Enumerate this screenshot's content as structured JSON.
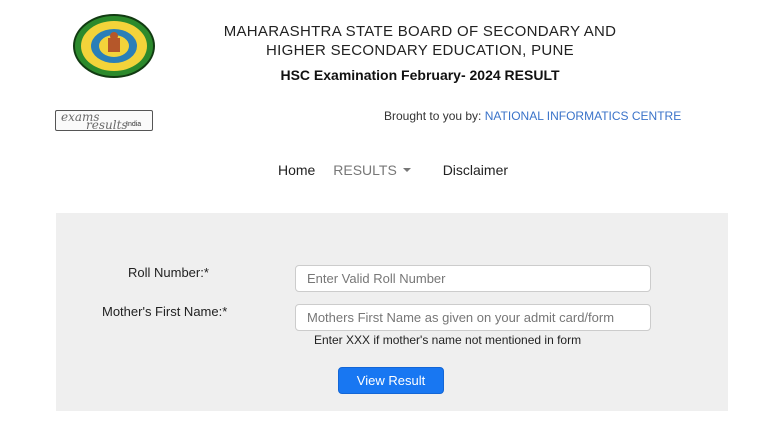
{
  "header": {
    "board_line1": "MAHARASHTRA STATE BOARD OF SECONDARY AND",
    "board_line2": "HIGHER SECONDARY EDUCATION, PUNE",
    "exam_title": "HSC Examination February- 2024 RESULT"
  },
  "partner": {
    "logo_word1": "exams",
    "logo_word2": "results",
    "logo_word3": "India",
    "brought_by_prefix": "Brought to you by:",
    "brought_by_org": "NATIONAL INFORMATICS CENTRE"
  },
  "nav": {
    "home": "Home",
    "results": "RESULTS",
    "disclaimer": "Disclaimer"
  },
  "form": {
    "roll_label": "Roll Number:*",
    "roll_placeholder": "Enter Valid Roll Number",
    "mother_label": "Mother's First Name:*",
    "mother_placeholder": "Mothers First Name as given on your admit card/form",
    "hint": "Enter XXX if mother's name not mentioned in form",
    "submit_label": "View Result"
  },
  "colors": {
    "accent": "#1877f2",
    "link": "#3a73c9",
    "panel": "#efefef"
  }
}
